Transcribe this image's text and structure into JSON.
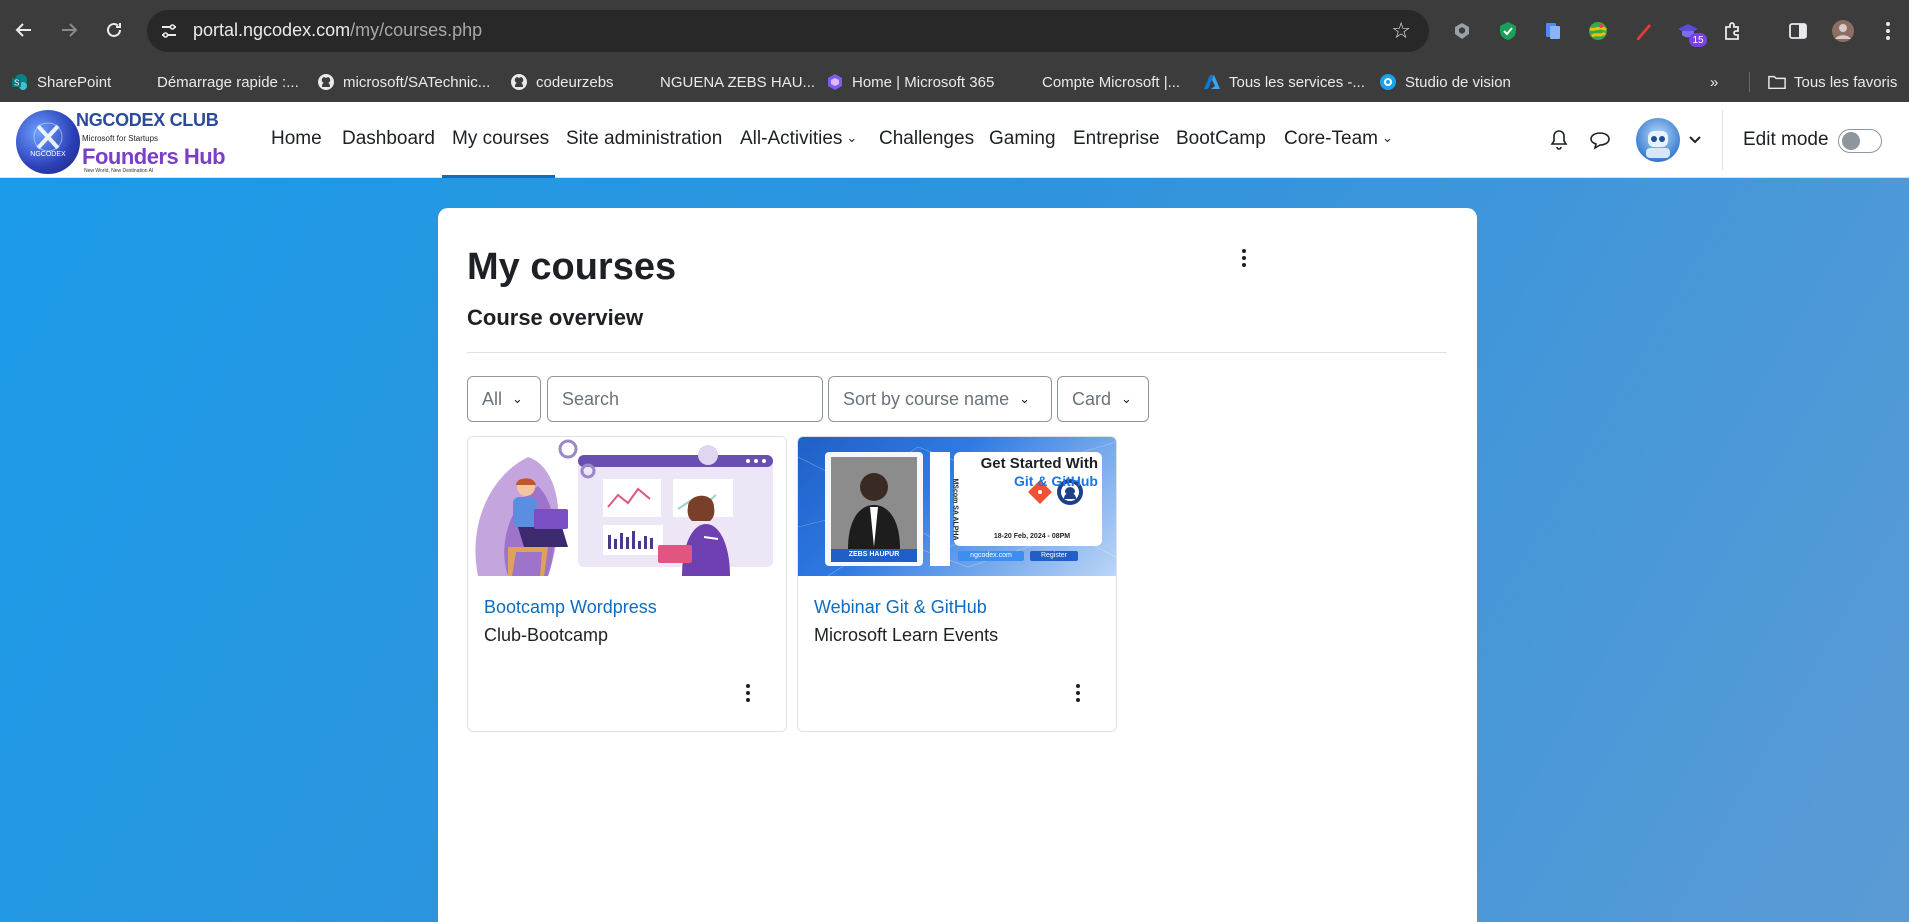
{
  "browser": {
    "url_domain": "portal.ngcodex.com",
    "url_path": "/my/courses.php",
    "extension_badge": "15",
    "bookmarks": [
      {
        "label": "SharePoint",
        "icon": "sharepoint-icon"
      },
      {
        "label": "Démarrage rapide :...",
        "icon": "microsoft-logo-icon"
      },
      {
        "label": "microsoft/SATechnic...",
        "icon": "github-icon"
      },
      {
        "label": "codeurzebs",
        "icon": "github-icon"
      },
      {
        "label": "NGUENA ZEBS HAU...",
        "icon": "microsoft-logo-icon"
      },
      {
        "label": "Home | Microsoft 365",
        "icon": "microsoft-365-icon"
      },
      {
        "label": "Compte Microsoft |...",
        "icon": "microsoft-logo-icon"
      },
      {
        "label": "Tous les services -...",
        "icon": "azure-icon"
      },
      {
        "label": "Studio de vision",
        "icon": "vision-studio-icon"
      }
    ],
    "all_bookmarks": "Tous les favoris"
  },
  "logo": {
    "club": "NGCODEX CLUB",
    "ms": "Microsoft for Startups",
    "hub": "Founders Hub",
    "tag": "NGCODEX",
    "tagline": "New World, New Destination AI"
  },
  "nav": {
    "home": "Home",
    "dashboard": "Dashboard",
    "my_courses": "My courses",
    "site_admin": "Site administration",
    "all_activities": "All-Activities",
    "challenges": "Challenges",
    "gaming": "Gaming",
    "entreprise": "Entreprise",
    "bootcamp": "BootCamp",
    "core_team": "Core-Team",
    "edit_mode": "Edit mode",
    "edit_mode_on": false
  },
  "page": {
    "title": "My courses",
    "section": "Course overview",
    "filter": "All",
    "search_placeholder": "Search",
    "sort": "Sort by course name",
    "view": "Card"
  },
  "courses": [
    {
      "name": "Bootcamp Wordpress",
      "category": "Club-Bootcamp"
    },
    {
      "name": "Webinar Git & GitHub",
      "category": "Microsoft Learn Events",
      "banner": {
        "line1": "Get Started With",
        "line2": "Git & GitHub",
        "speaker": "ZEBS HAUPUR",
        "side": "MScom SA ALPHA",
        "date": "18-20 Feb, 2024 - 08PM",
        "site": "ngcodex.com",
        "register": "Register"
      }
    }
  ],
  "colors": {
    "link": "#0f6cbf",
    "page_gradient_start": "#1b9be8",
    "page_gradient_end": "#5b9bd5"
  }
}
